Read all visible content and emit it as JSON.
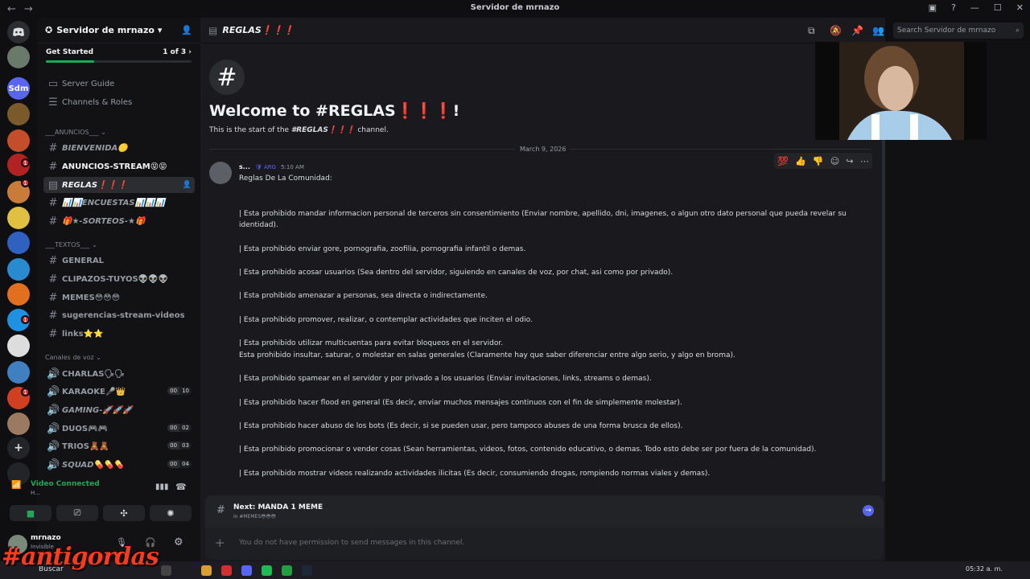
{
  "window": {
    "title": "Servidor de mrnazo",
    "back": "←",
    "forward": "→"
  },
  "rail": {
    "servers": [
      {
        "label": "Sdm",
        "color": "#5865f2"
      },
      {
        "label": "",
        "color": "#7a5a2a"
      },
      {
        "label": "",
        "color": "#c44d2a"
      },
      {
        "label": "",
        "color": "#b22222"
      },
      {
        "label": "",
        "color": "#c97b3a"
      },
      {
        "label": "",
        "color": "#e0c040"
      },
      {
        "label": "",
        "color": "#3060c0"
      },
      {
        "label": "",
        "color": "#2a8ad0"
      },
      {
        "label": "",
        "color": "#e07020"
      },
      {
        "label": "",
        "color": "#2090e0"
      },
      {
        "label": "",
        "color": "#dddddd"
      },
      {
        "label": "",
        "color": "#4080c0"
      },
      {
        "label": "",
        "color": "#d04020"
      },
      {
        "label": "",
        "color": "#9a7a60"
      }
    ],
    "badges": [
      "1",
      "1",
      "1",
      "1"
    ],
    "add_label": "+"
  },
  "sidebar": {
    "server_name": "Servidor de mrnazo",
    "get_started": {
      "label": "Get Started",
      "progress": "1 of 3",
      "fraction": 0.33
    },
    "guide": [
      {
        "label": "Server Guide"
      },
      {
        "label": "Channels & Roles"
      }
    ],
    "cat_anuncios": "___ANUNCIOS___",
    "anuncios": [
      {
        "label": "BIENVENIDA🟡"
      },
      {
        "label": "ANUNCIOS-STREAM😝😝"
      },
      {
        "label": "REGLAS❗❗❗"
      },
      {
        "label": "📊📊ENCUESTAS📊📊📊"
      },
      {
        "label": "🎁★-SORTEOS-★🎁"
      }
    ],
    "cat_textos": "___TEXTOS___",
    "textos": [
      {
        "label": "GENERAL"
      },
      {
        "label": "CLIPAZOS-TUYOS👽👽👽"
      },
      {
        "label": "MEMES😳😳😳"
      },
      {
        "label": "sugerencias-stream-videos"
      },
      {
        "label": "links⭐⭐"
      }
    ],
    "cat_voz": "Canales de voz",
    "voz": [
      {
        "label": "CHARLAS🗣🗣",
        "a": "",
        "b": ""
      },
      {
        "label": "KARAOKE🎤👑",
        "a": "00",
        "b": "10"
      },
      {
        "label": "GAMING-🚀🚀🚀",
        "a": "",
        "b": ""
      },
      {
        "label": "DUOS🎮🎮",
        "a": "00",
        "b": "02"
      },
      {
        "label": "TRIOS🧸🧸",
        "a": "00",
        "b": "03"
      },
      {
        "label": "SQUAD💊💊💊",
        "a": "00",
        "b": "04"
      }
    ]
  },
  "voice_panel": {
    "status": "Video Connected",
    "sub": "H..."
  },
  "user_panel": {
    "name": "mrnazo",
    "status": "Invisible"
  },
  "chat": {
    "channel": "REGLAS❗❗❗",
    "search_placeholder": "Search Servidor de mrnazo",
    "welcome_title": "Welcome to #REGLAS❗❗❗!",
    "welcome_sub_pre": "This is the start of the ",
    "welcome_sub_channel": "#REGLAS❗❗❗",
    "welcome_sub_post": " channel.",
    "date": "March 9, 2026",
    "author": "s...",
    "role_tag": "ARG",
    "time": "5:10 AM",
    "intro": "Reglas De La Comunidad:",
    "rules": [
      "| Esta prohibido mandar informacion personal de terceros sin consentimiento (Enviar nombre, apellido, dni, imagenes, o algun otro dato personal que pueda revelar su identidad).",
      "| Esta prohibido enviar gore, pornografia, zoofilia, pornografia infantil o demas.",
      "| Esta prohibido acosar usuarios (Sea dentro del servidor, siguiendo en canales de voz, por chat, asi como por privado).",
      "| Esta prohibido amenazar a personas, sea directa o indirectamente.",
      "| Esta prohibido promover, realizar, o contemplar actividades que inciten el odio.",
      "| Esta prohibido utilizar multicuentas para evitar bloqueos en el servidor.",
      "Esta prohibido insultar, saturar, o molestar en salas generales (Claramente hay que saber diferenciar entre algo serio, y algo en broma).",
      "| Esta prohibido spamear en el servidor y por privado a los usuarios (Enviar invitaciones, links, streams o demas).",
      "| Esta prohibido hacer flood en general (Es decir, enviar muchos mensajes continuos con el fin de simplemente molestar).",
      "| Esta prohibido hacer abuso de los bots (Es decir, si se pueden usar, pero tampoco abuses de una forma brusca de ellos).",
      "| Esta prohibido promocionar o vender cosas (Sean herramientas, videos, fotos, contenido educativo, o demas. Todo esto debe ser por fuera de la comunidad).",
      "| Esta prohibido mostrar videos realizando actividades ilicitas (Es decir, consumiendo drogas, rompiendo normas viales y demas)."
    ],
    "next_label": "Next: MANDA 1 MEME",
    "next_sub": "in #MEMES😳😳😳",
    "composer_placeholder": "You do not have permission to send messages in this channel."
  },
  "overlay_text": "#antigordas",
  "taskbar": {
    "search": "Buscar",
    "time": "05:32 a. m."
  }
}
